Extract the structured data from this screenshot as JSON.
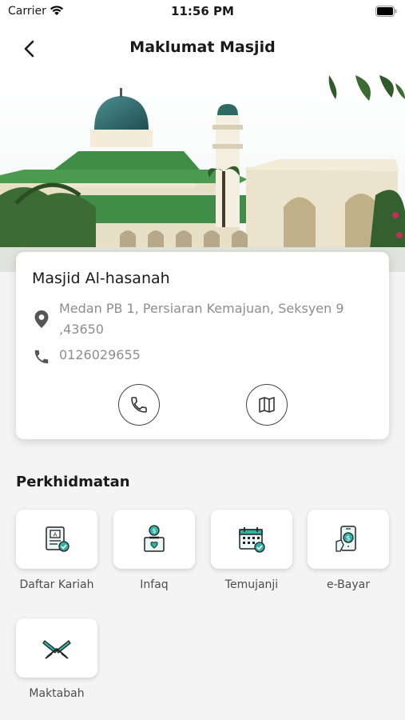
{
  "status": {
    "carrier": "Carrier",
    "time": "11:56 PM"
  },
  "nav": {
    "title": "Maklumat Masjid"
  },
  "mosque": {
    "name": "Masjid Al-hasanah",
    "address": "Medan PB 1, Persiaran Kemajuan, Seksyen 9 ,43650",
    "phone": "0126029655"
  },
  "services": {
    "title": "Perkhidmatan",
    "items": [
      {
        "label": "Daftar Kariah",
        "icon": "registration-form-icon"
      },
      {
        "label": "Infaq",
        "icon": "donation-box-icon"
      },
      {
        "label": "Temujanji",
        "icon": "calendar-check-icon"
      },
      {
        "label": "e-Bayar",
        "icon": "mobile-payment-icon"
      },
      {
        "label": "Maktabah",
        "icon": "quran-book-icon"
      }
    ]
  },
  "colors": {
    "accent": "#2fb3a6",
    "text_secondary": "#8d8d8d"
  }
}
